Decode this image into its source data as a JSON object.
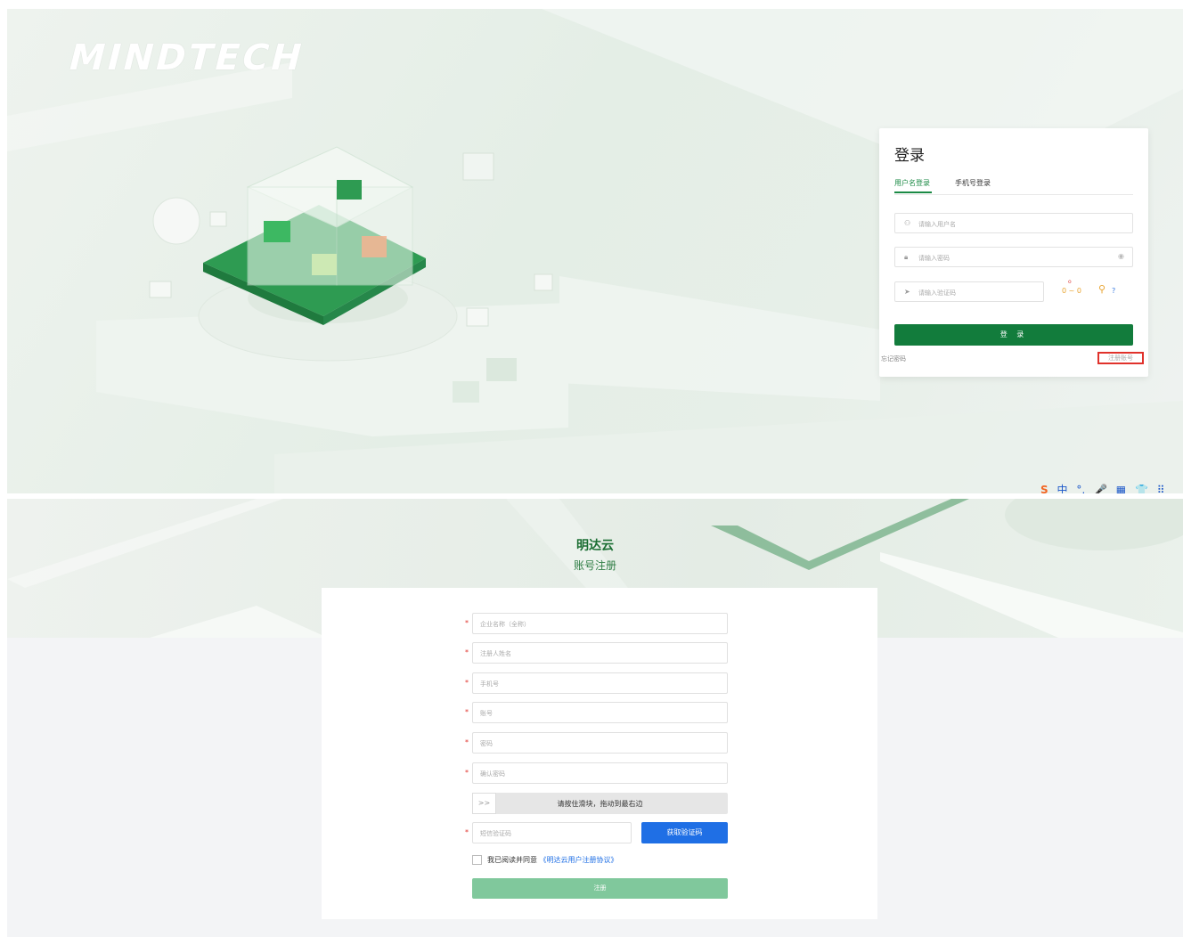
{
  "top": {
    "logo": "MINDTECH",
    "login": {
      "title": "登录",
      "tabs": [
        "用户名登录",
        "手机号登录"
      ],
      "username_placeholder": "请输入用户名",
      "password_placeholder": "请输入密码",
      "captcha_placeholder": "请输入验证码",
      "captcha_text": "0 ~ 0",
      "captcha_question": "?",
      "login_button": "登 录",
      "forgot": "忘记密码",
      "register": "注册账号"
    },
    "ime": [
      "中",
      "°,",
      "🎤",
      "▦",
      "👕",
      "⠿"
    ]
  },
  "bottom": {
    "brand": "明达云",
    "subtitle": "账号注册",
    "fields": [
      {
        "placeholder": "企业名称（全称）"
      },
      {
        "placeholder": "注册人姓名"
      },
      {
        "placeholder": "手机号"
      },
      {
        "placeholder": "账号"
      },
      {
        "placeholder": "密码"
      },
      {
        "placeholder": "确认密码"
      }
    ],
    "required_mark": "*",
    "slider": {
      "handle": ">>",
      "hint": "请按住滑块，拖动到最右边"
    },
    "sms": {
      "placeholder": "短信验证码",
      "button": "获取验证码"
    },
    "agreement": {
      "text": "我已阅读并同意",
      "link": "《明达云用户注册协议》"
    },
    "submit": "注册"
  },
  "colors": {
    "primary_green": "#127c3c",
    "tab_green": "#1b8a45",
    "blue": "#1f6fe5",
    "submit_disabled": "#80c89c",
    "highlight_red": "#e0322b"
  }
}
